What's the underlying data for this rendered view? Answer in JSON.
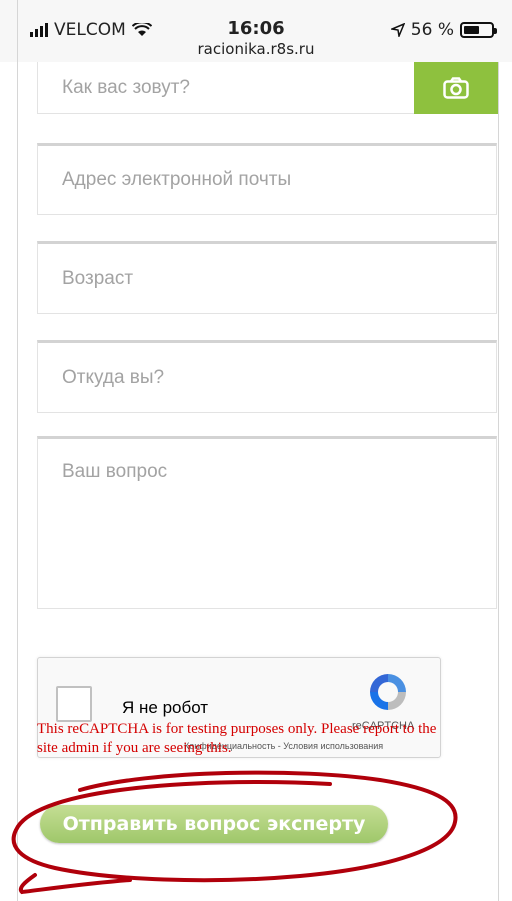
{
  "status_bar": {
    "carrier": "VELCOM",
    "time": "16:06",
    "url": "racionika.r8s.ru",
    "battery": "56 %",
    "battery_level": 0.56
  },
  "form": {
    "name_placeholder": "Как вас зовут?",
    "email_placeholder": "Адрес электронной почты",
    "age_placeholder": "Возраст",
    "location_placeholder": "Откуда вы?",
    "question_placeholder": "Ваш вопрос",
    "submit_label": "Отправить вопрос эксперту"
  },
  "recaptcha": {
    "label": "Я не робот",
    "brand": "reCAPTCHA",
    "links": "Конфиденциальность - Условия использования",
    "warning": "This reCAPTCHA is for testing purposes only. Please report to the site admin if you are seeing this."
  },
  "colors": {
    "accent_green": "#8ec13e",
    "annotation_red": "#b0000b",
    "warning_red": "#d40000"
  }
}
